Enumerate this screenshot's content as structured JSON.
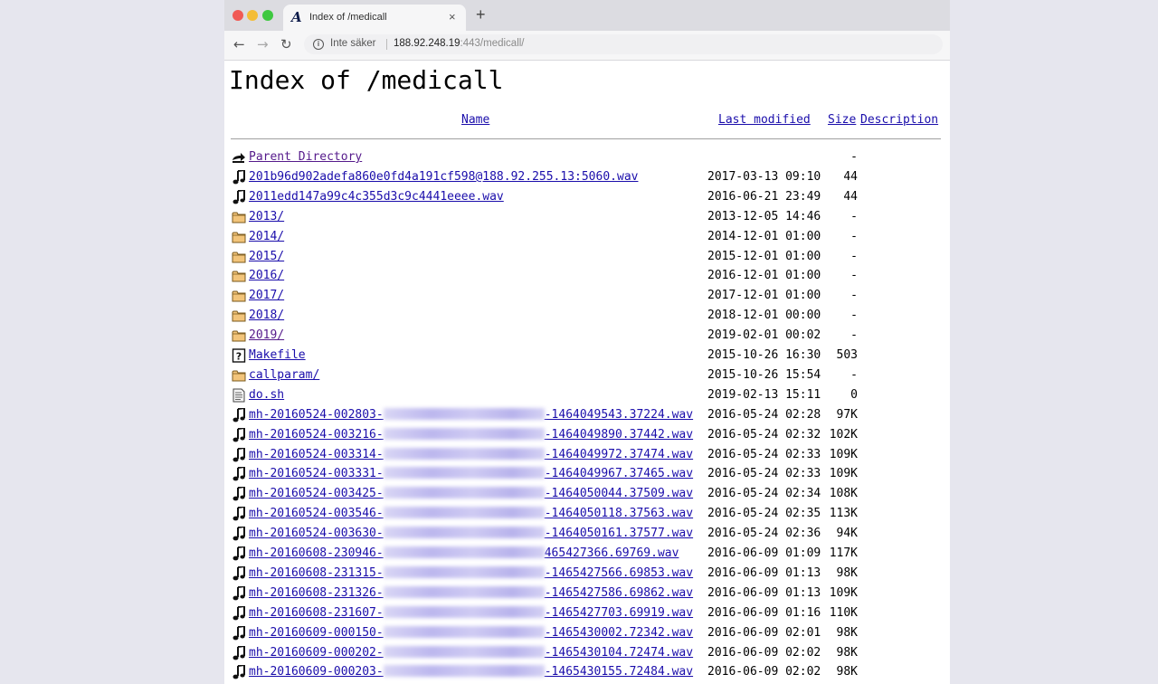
{
  "browser": {
    "tab_title": "Index of /medicall",
    "tab_favicon": "A",
    "tab_close": "×",
    "new_tab": "+",
    "security_label": "Inte säker",
    "url_host": "188.92.248.19",
    "url_rest": ":443/medicall/"
  },
  "icons": {
    "back": "arrow-left-icon",
    "forward": "arrow-right-icon",
    "reload": "reload-icon",
    "info": "info-circle-icon",
    "parent": "back-arrow-icon",
    "sound": "sound-file-icon",
    "folder": "folder-icon",
    "unknown": "unknown-file-icon",
    "text": "text-file-icon"
  },
  "page": {
    "title": "Index of /medicall",
    "headers": {
      "name": "Name",
      "last_modified": "Last modified",
      "size": "Size",
      "description": "Description"
    }
  },
  "colors": {
    "link": "#1a0dab",
    "visited": "#551a8b",
    "folder": "#f2c47a"
  },
  "entries": [
    {
      "type": "parent",
      "name": "Parent Directory",
      "date": "",
      "size": "-",
      "visited": true
    },
    {
      "type": "sound",
      "name": "201b96d902adefa860e0fd4a191cf598@188.92.255.13:5060.wav",
      "date": "2017-03-13 09:10",
      "size": "44"
    },
    {
      "type": "sound",
      "name": "2011edd147a99c4c355d3c9c4441eeee.wav",
      "date": "2016-06-21 23:49",
      "size": "44"
    },
    {
      "type": "folder",
      "name": "2013/",
      "date": "2013-12-05 14:46",
      "size": "-"
    },
    {
      "type": "folder",
      "name": "2014/",
      "date": "2014-12-01 01:00",
      "size": "-"
    },
    {
      "type": "folder",
      "name": "2015/",
      "date": "2015-12-01 01:00",
      "size": "-"
    },
    {
      "type": "folder",
      "name": "2016/",
      "date": "2016-12-01 01:00",
      "size": "-"
    },
    {
      "type": "folder",
      "name": "2017/",
      "date": "2017-12-01 01:00",
      "size": "-"
    },
    {
      "type": "folder",
      "name": "2018/",
      "date": "2018-12-01 00:00",
      "size": "-"
    },
    {
      "type": "folder",
      "name": "2019/",
      "date": "2019-02-01 00:02",
      "size": "-",
      "visited": true
    },
    {
      "type": "unknown",
      "name": "Makefile",
      "date": "2015-10-26 16:30",
      "size": "503"
    },
    {
      "type": "folder",
      "name": "callparam/",
      "date": "2015-10-26 15:54",
      "size": "-"
    },
    {
      "type": "text",
      "name": "do.sh",
      "date": "2019-02-13 15:11",
      "size": "0"
    },
    {
      "type": "sound",
      "name_prefix": "mh-20160524-002803-",
      "name_suffix": "-1464049543.37224.wav",
      "date": "2016-05-24 02:28",
      "size": "97K"
    },
    {
      "type": "sound",
      "name_prefix": "mh-20160524-003216-",
      "name_suffix": "-1464049890.37442.wav",
      "date": "2016-05-24 02:32",
      "size": "102K"
    },
    {
      "type": "sound",
      "name_prefix": "mh-20160524-003314-",
      "name_suffix": "-1464049972.37474.wav",
      "date": "2016-05-24 02:33",
      "size": "109K"
    },
    {
      "type": "sound",
      "name_prefix": "mh-20160524-003331-",
      "name_suffix": "-1464049967.37465.wav",
      "date": "2016-05-24 02:33",
      "size": "109K"
    },
    {
      "type": "sound",
      "name_prefix": "mh-20160524-003425-",
      "name_suffix": "-1464050044.37509.wav",
      "date": "2016-05-24 02:34",
      "size": "108K"
    },
    {
      "type": "sound",
      "name_prefix": "mh-20160524-003546-",
      "name_suffix": "-1464050118.37563.wav",
      "date": "2016-05-24 02:35",
      "size": "113K"
    },
    {
      "type": "sound",
      "name_prefix": "mh-20160524-003630-",
      "name_suffix": "-1464050161.37577.wav",
      "date": "2016-05-24 02:36",
      "size": "94K"
    },
    {
      "type": "sound",
      "name_prefix": "mh-20160608-230946-",
      "name_suffix": "465427366.69769.wav",
      "date": "2016-06-09 01:09",
      "size": "117K"
    },
    {
      "type": "sound",
      "name_prefix": "mh-20160608-231315-",
      "name_suffix": "-1465427566.69853.wav",
      "date": "2016-06-09 01:13",
      "size": "98K"
    },
    {
      "type": "sound",
      "name_prefix": "mh-20160608-231326-",
      "name_suffix": "-1465427586.69862.wav",
      "date": "2016-06-09 01:13",
      "size": "109K"
    },
    {
      "type": "sound",
      "name_prefix": "mh-20160608-231607-",
      "name_suffix": "-1465427703.69919.wav",
      "date": "2016-06-09 01:16",
      "size": "110K"
    },
    {
      "type": "sound",
      "name_prefix": "mh-20160609-000150-",
      "name_suffix": "-1465430002.72342.wav",
      "date": "2016-06-09 02:01",
      "size": "98K"
    },
    {
      "type": "sound",
      "name_prefix": "mh-20160609-000202-",
      "name_suffix": "-1465430104.72474.wav",
      "date": "2016-06-09 02:02",
      "size": "98K"
    },
    {
      "type": "sound",
      "name_prefix": "mh-20160609-000203-",
      "name_suffix": "-1465430155.72484.wav",
      "date": "2016-06-09 02:02",
      "size": "98K"
    }
  ]
}
